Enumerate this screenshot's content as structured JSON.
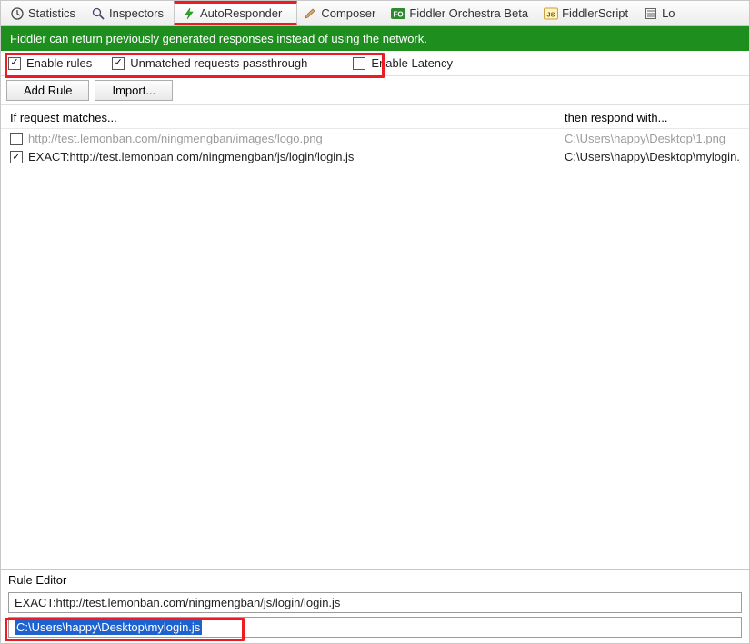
{
  "tabs": [
    {
      "id": "statistics",
      "label": "Statistics",
      "icon": "clock-icon"
    },
    {
      "id": "inspectors",
      "label": "Inspectors",
      "icon": "magnifier-icon"
    },
    {
      "id": "autoresponder",
      "label": "AutoResponder",
      "icon": "lightning-icon"
    },
    {
      "id": "composer",
      "label": "Composer",
      "icon": "pencil-icon"
    },
    {
      "id": "orchestra",
      "label": "Fiddler Orchestra Beta",
      "icon": "fo-icon"
    },
    {
      "id": "fiddlerscript",
      "label": "FiddlerScript",
      "icon": "script-icon"
    },
    {
      "id": "log",
      "label": "Lo",
      "icon": "log-icon"
    }
  ],
  "hint": "Fiddler can return previously generated responses instead of using the network.",
  "options": {
    "enable_rules": {
      "label": "Enable rules",
      "checked": true
    },
    "passthrough": {
      "label": "Unmatched requests passthrough",
      "checked": true
    },
    "enable_latency": {
      "label": "Enable Latency",
      "checked": false
    }
  },
  "buttons": {
    "add_rule": "Add Rule",
    "import": "Import..."
  },
  "list": {
    "header_match": "If request matches...",
    "header_resp": "then respond with...",
    "rows": [
      {
        "enabled": false,
        "match": "http://test.lemonban.com/ningmengban/images/logo.png",
        "resp": "C:\\Users\\happy\\Desktop\\1.png"
      },
      {
        "enabled": true,
        "match": "EXACT:http://test.lemonban.com/ningmengban/js/login/login.js",
        "resp": "C:\\Users\\happy\\Desktop\\mylogin.js"
      }
    ]
  },
  "rule_editor": {
    "title": "Rule Editor",
    "match_value": "EXACT:http://test.lemonban.com/ningmengban/js/login/login.js",
    "resp_value": "C:\\Users\\happy\\Desktop\\mylogin.js"
  }
}
